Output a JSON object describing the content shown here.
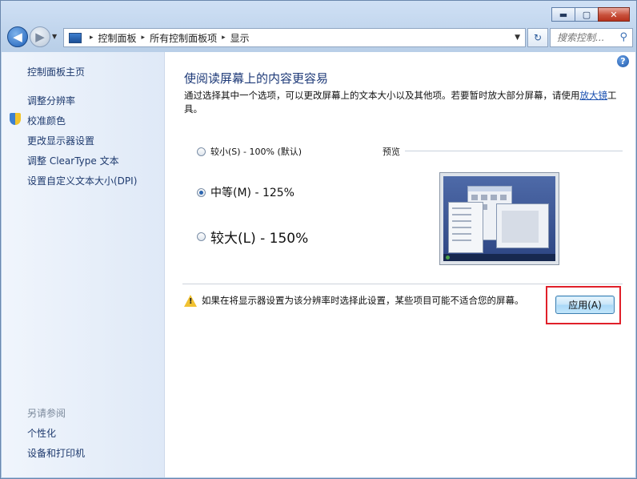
{
  "window": {
    "caption_buttons": {
      "minimize": "▬",
      "maximize": "▢",
      "close": "✕"
    }
  },
  "nav": {
    "back_icon": "◀",
    "forward_icon": "▶",
    "history_dropdown": "▼",
    "breadcrumb": [
      "控制面板",
      "所有控制面板项",
      "显示"
    ],
    "breadcrumb_separator": "▸",
    "address_dropdown": "▼",
    "refresh_icon": "↻",
    "search_placeholder": "搜索控制...",
    "search_icon": "⚲"
  },
  "sidebar": {
    "home": "控制面板主页",
    "items": [
      "调整分辨率",
      "校准颜色",
      "更改显示器设置",
      "调整 ClearType 文本",
      "设置自定义文本大小(DPI)"
    ],
    "see_also_title": "另请参阅",
    "see_also": [
      "个性化",
      "设备和打印机"
    ]
  },
  "content": {
    "help_icon": "?",
    "title": "使阅读屏幕上的内容更容易",
    "description_prefix": "通过选择其中一个选项，可以更改屏幕上的文本大小以及其他项。若要暂时放大部分屏幕，请使用",
    "description_link": "放大镜",
    "description_suffix": "工具。",
    "options": [
      {
        "label": "较小(S) - 100% (默认)",
        "selected": false
      },
      {
        "label": "中等(M) - 125%",
        "selected": true
      },
      {
        "label": "较大(L) - 150%",
        "selected": false
      }
    ],
    "preview_label": "预览",
    "warning_icon": "!",
    "warning_text": "如果在将显示器设置为该分辨率时选择此设置，某些项目可能不适合您的屏幕。",
    "apply_button": "应用(A)"
  },
  "colors": {
    "link": "#1e3a6e",
    "title": "#1e3a78",
    "highlight_box": "#e0202a"
  }
}
